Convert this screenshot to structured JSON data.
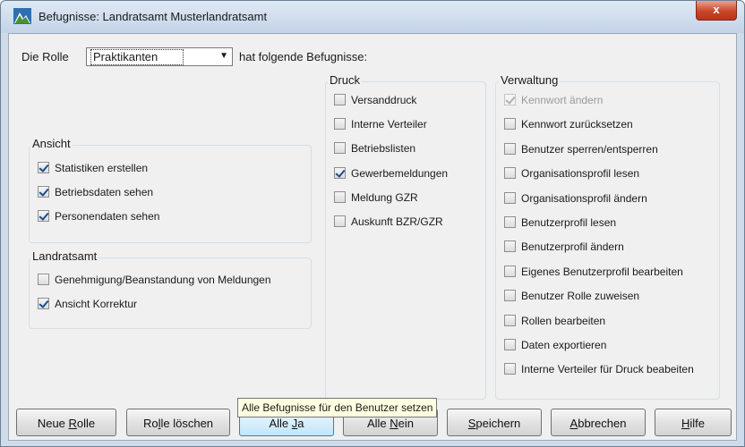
{
  "window": {
    "title": "Befugnisse: Landratsamt Musterlandratsamt",
    "close_label": "x",
    "icon": "app-icon"
  },
  "role_bar": {
    "prefix": "Die Rolle",
    "selected_role": "Praktikanten",
    "suffix": "hat folgende Befugnisse:"
  },
  "groups": {
    "ansicht": {
      "title": "Ansicht",
      "items": [
        {
          "label": "Statistiken erstellen",
          "checked": true
        },
        {
          "label": "Betriebsdaten sehen",
          "checked": true
        },
        {
          "label": "Personendaten sehen",
          "checked": true
        }
      ]
    },
    "landratsamt": {
      "title": "Landratsamt",
      "items": [
        {
          "label": "Genehmigung/Beanstandung von Meldungen",
          "checked": false
        },
        {
          "label": "Ansicht Korrektur",
          "checked": true
        }
      ]
    },
    "druck": {
      "title": "Druck",
      "items": [
        {
          "label": "Versanddruck",
          "checked": false
        },
        {
          "label": "Interne Verteiler",
          "checked": false
        },
        {
          "label": "Betriebslisten",
          "checked": false
        },
        {
          "label": "Gewerbemeldungen",
          "checked": true
        },
        {
          "label": "Meldung GZR",
          "checked": false
        },
        {
          "label": "Auskunft BZR/GZR",
          "checked": false
        }
      ]
    },
    "verwaltung": {
      "title": "Verwaltung",
      "items": [
        {
          "label": "Kennwort ändern",
          "checked": true,
          "disabled": true
        },
        {
          "label": "Kennwort zurücksetzen",
          "checked": false
        },
        {
          "label": "Benutzer sperren/entsperren",
          "checked": false
        },
        {
          "label": "Organisationsprofil lesen",
          "checked": false
        },
        {
          "label": "Organisationsprofil ändern",
          "checked": false
        },
        {
          "label": "Benutzerprofil lesen",
          "checked": false
        },
        {
          "label": "Benutzerprofil ändern",
          "checked": false
        },
        {
          "label": "Eigenes Benutzerprofil bearbeiten",
          "checked": false
        },
        {
          "label": "Benutzer Rolle zuweisen",
          "checked": false
        },
        {
          "label": "Rollen bearbeiten",
          "checked": false
        },
        {
          "label": "Daten exportieren",
          "checked": false
        },
        {
          "label": "Interne Verteiler für Druck beabeiten",
          "checked": false
        }
      ]
    }
  },
  "buttons": [
    {
      "id": "neue-rolle",
      "label": "Neue Rolle"
    },
    {
      "id": "rolle-loeschen",
      "label": "Rolle löschen"
    },
    {
      "id": "alle-ja",
      "label": "Alle Ja"
    },
    {
      "id": "alle-nein",
      "label": "Alle Nein"
    },
    {
      "id": "speichern",
      "label": "Speichern"
    },
    {
      "id": "abbrechen",
      "label": "Abbrechen"
    },
    {
      "id": "hilfe",
      "label": "Hilfe"
    }
  ],
  "tooltip": "Alle Befugnisse für den Benutzer setzen",
  "colors": {
    "window_border": "#6c7f96",
    "close_button": "#c9462a",
    "tooltip_bg": "#ffffe1"
  }
}
